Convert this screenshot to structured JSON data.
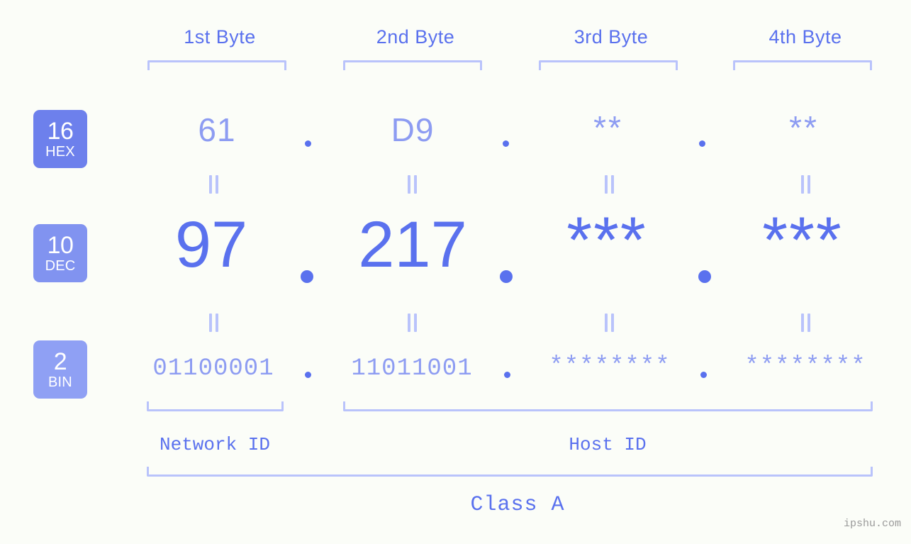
{
  "background_color": "#fbfdf8",
  "accent_color": "#5a71ee",
  "accent_light_color": "#8d9cf2",
  "bracket_color": "#b9c3fb",
  "byte_headers": [
    {
      "label": "1st Byte"
    },
    {
      "label": "2nd Byte"
    },
    {
      "label": "3rd Byte"
    },
    {
      "label": "4th Byte"
    }
  ],
  "bases": [
    {
      "number": "16",
      "name": "HEX",
      "color": "#6d80ec"
    },
    {
      "number": "10",
      "name": "DEC",
      "color": "#8193f0"
    },
    {
      "number": "2",
      "name": "BIN",
      "color": "#8fa0f4"
    }
  ],
  "rows": {
    "hex": {
      "base_number": "16",
      "base_name": "HEX",
      "values": [
        "61",
        "D9",
        "**",
        "**"
      ],
      "separators": [
        ".",
        ".",
        "."
      ]
    },
    "dec": {
      "base_number": "10",
      "base_name": "DEC",
      "values": [
        "97",
        "217",
        "***",
        "***"
      ],
      "separators": [
        ".",
        ".",
        "."
      ]
    },
    "bin": {
      "base_number": "2",
      "base_name": "BIN",
      "values": [
        "01100001",
        "11011001",
        "********",
        "********"
      ],
      "separators": [
        ".",
        ".",
        "."
      ]
    }
  },
  "equals_glyph": "||",
  "sections": [
    {
      "label": "Network ID"
    },
    {
      "label": "Host ID"
    }
  ],
  "class": {
    "label": "Class A"
  },
  "watermark": {
    "text": "ipshu.com"
  }
}
